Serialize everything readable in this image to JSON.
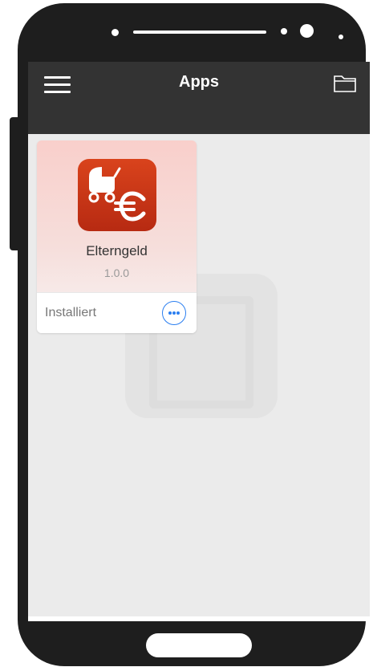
{
  "appbar": {
    "title": "Apps",
    "menu_icon": "hamburger-menu-icon",
    "folder_icon": "folder-icon"
  },
  "apps": [
    {
      "name": "Elterngeld",
      "version": "1.0.0",
      "status": "Installiert",
      "icon": "stroller-euro-icon",
      "more_icon": "ellipsis-icon"
    }
  ],
  "colors": {
    "appbar_bg": "#333333",
    "screen_bg": "#ebebeb",
    "icon_red": "#c8321a",
    "accent_blue": "#2a7ef0"
  }
}
